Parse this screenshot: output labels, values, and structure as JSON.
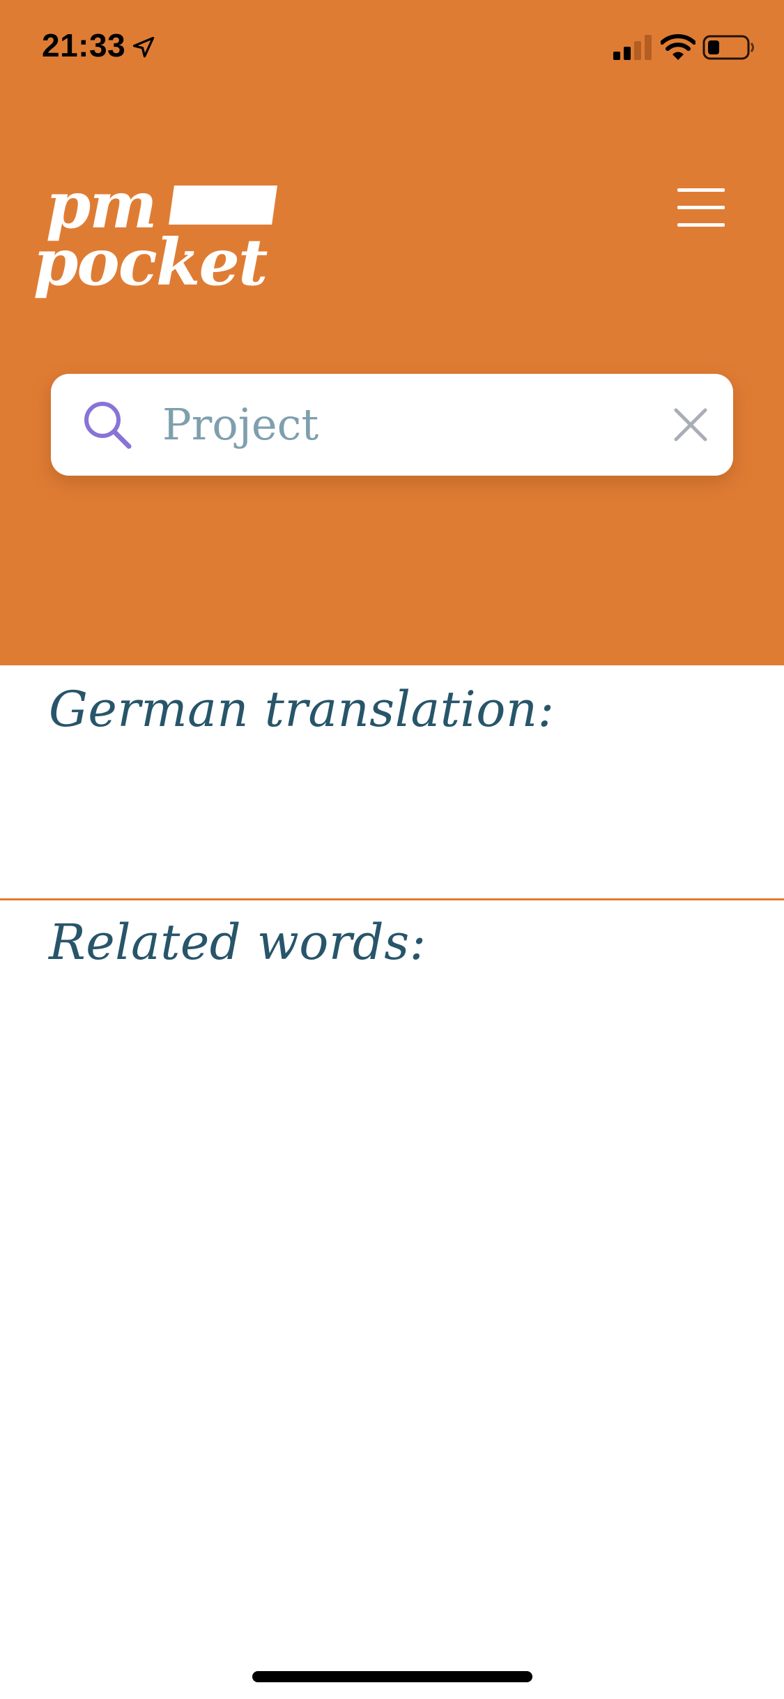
{
  "status_bar": {
    "time": "21:33",
    "icons": [
      "location-arrow-icon",
      "cellular-signal-icon",
      "wifi-icon",
      "battery-icon"
    ]
  },
  "header": {
    "logo_line1": "pm",
    "logo_line2": "pocket",
    "menu_icon": "hamburger-menu-icon"
  },
  "search": {
    "value": "Project",
    "placeholder": "",
    "search_icon": "search-icon",
    "clear_icon": "close-icon"
  },
  "content": {
    "german_translation_label": "German translation:",
    "related_words_label": "Related words:"
  },
  "colors": {
    "header_background": "#df7c34",
    "title_text": "#27556a",
    "search_text": "#7f9fae",
    "search_icon": "#8a73d6",
    "divider": "#df7c34"
  }
}
